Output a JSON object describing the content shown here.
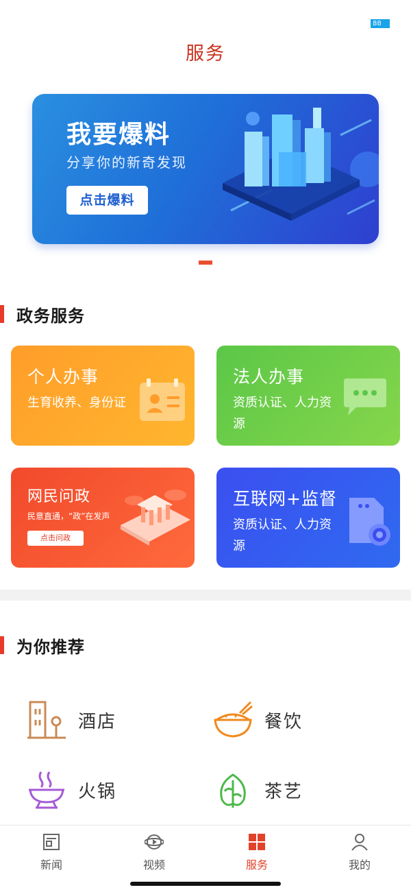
{
  "status": {
    "battery": "88"
  },
  "header": {
    "title": "服务"
  },
  "banner": {
    "title": "我要爆料",
    "subtitle": "分享你的新奇发现",
    "button": "点击爆料"
  },
  "gov_section": {
    "title": "政务服务",
    "cards": [
      {
        "title": "个人办事",
        "desc": "生育收养、身份证",
        "icon": "id-card-icon"
      },
      {
        "title": "法人办事",
        "desc": "资质认证、人力资源",
        "icon": "chat-icon"
      },
      {
        "title": "网民问政",
        "desc": "民意直通，“政”在发声",
        "button": "点击问政",
        "icon": "government-building-icon"
      },
      {
        "title": "互联网+监督",
        "desc": "资质认证、人力资源",
        "icon": "document-settings-icon"
      }
    ]
  },
  "recommend_section": {
    "title": "为你推荐",
    "items": [
      {
        "label": "酒店",
        "icon": "hotel-icon"
      },
      {
        "label": "餐饮",
        "icon": "rice-bowl-icon"
      },
      {
        "label": "火锅",
        "icon": "hotpot-icon"
      },
      {
        "label": "茶艺",
        "icon": "tea-leaf-icon"
      }
    ]
  },
  "tabbar": {
    "tabs": [
      {
        "label": "新闻",
        "icon": "news-icon",
        "active": false
      },
      {
        "label": "视频",
        "icon": "video-icon",
        "active": false
      },
      {
        "label": "服务",
        "icon": "service-grid-icon",
        "active": true
      },
      {
        "label": "我的",
        "icon": "profile-icon",
        "active": false
      }
    ]
  },
  "colors": {
    "accent": "#e2422a",
    "card_orange": "#ff9d2a",
    "card_green": "#5bc748",
    "card_red": "#f14a2c",
    "card_blue": "#3b4ff0"
  }
}
